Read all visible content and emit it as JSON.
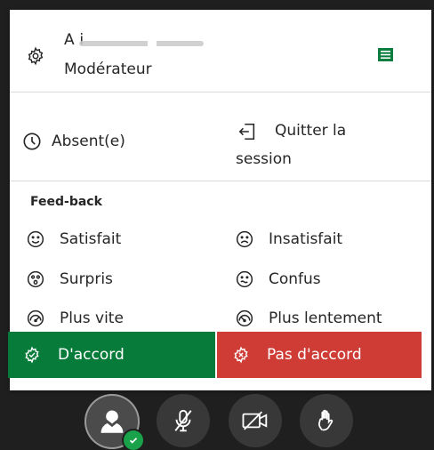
{
  "user": {
    "name": "A                          i",
    "role": "Modérateur"
  },
  "status": {
    "away_label": "Absent(e)",
    "leave_line1": "Quitter la",
    "leave_line2": "session"
  },
  "feedback": {
    "title": "Feed-back",
    "items": [
      {
        "label": "Satisfait",
        "icon": "smile-icon"
      },
      {
        "label": "Insatisfait",
        "icon": "frown-icon"
      },
      {
        "label": "Surpris",
        "icon": "surprised-icon"
      },
      {
        "label": "Confus",
        "icon": "confused-icon"
      },
      {
        "label": "Plus vite",
        "icon": "speedometer-fast-icon"
      },
      {
        "label": "Plus lentement",
        "icon": "speedometer-slow-icon"
      }
    ],
    "agree_label": "D'accord",
    "disagree_label": "Pas d'accord"
  },
  "colors": {
    "agree": "#077c3a",
    "disagree": "#cf3c36",
    "online": "#1aa24a",
    "toolbar": "#1f1f1f"
  }
}
